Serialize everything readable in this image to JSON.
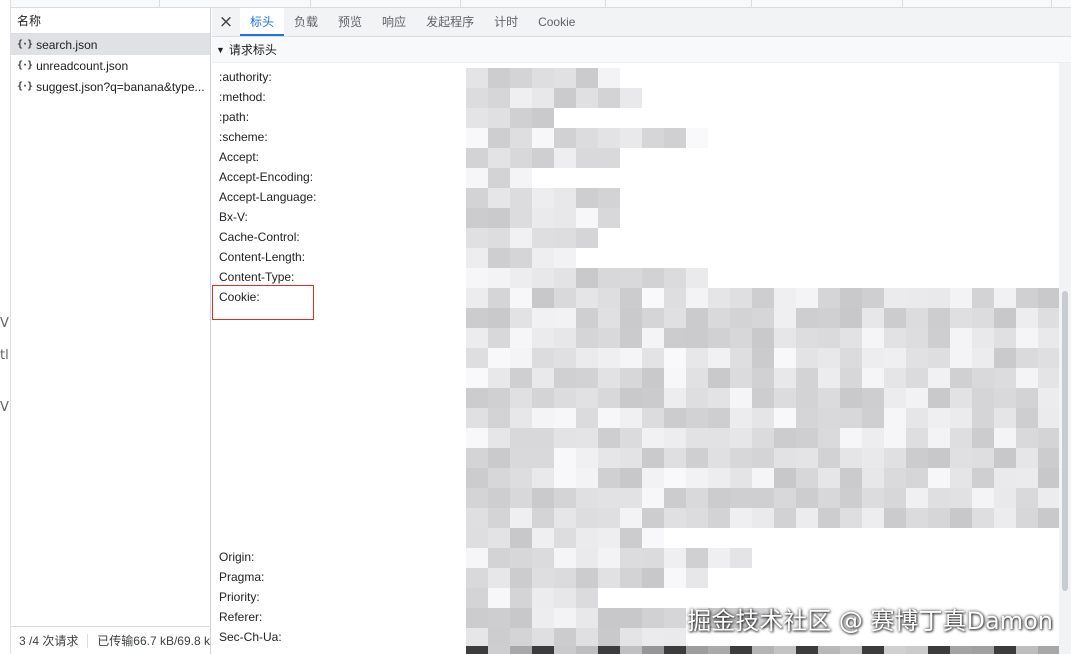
{
  "outside_fragments": [
    "V",
    "tl",
    "V"
  ],
  "request_list": {
    "header": "名称",
    "items": [
      {
        "icon": "{·}",
        "name": "search.json",
        "selected": true
      },
      {
        "icon": "{·}",
        "name": "unreadcount.json",
        "selected": false
      },
      {
        "icon": "{·}",
        "name": "suggest.json?q=banana&type...",
        "selected": false
      }
    ],
    "status": {
      "requests": "3 /4 次请求",
      "transferred": "已传输66.7 kB/69.8 k"
    }
  },
  "details": {
    "close_icon": "×",
    "tabs": [
      "标头",
      "负载",
      "预览",
      "响应",
      "发起程序",
      "计时",
      "Cookie"
    ],
    "active_tab": "标头",
    "section_title": "请求标头",
    "headers": [
      ":authority:",
      ":method:",
      ":path:",
      ":scheme:",
      "Accept:",
      "Accept-Encoding:",
      "Accept-Language:",
      "Bx-V:",
      "Cache-Control:",
      "Content-Length:",
      "Content-Type:",
      "Cookie:",
      "Origin:",
      "Pragma:",
      "Priority:",
      "Referer:",
      "Sec-Ch-Ua:"
    ],
    "highlighted_header": "Cookie:"
  },
  "watermark": "掘金技术社区 @ 赛博丁真Damon",
  "colors": {
    "accent": "#1a73e8",
    "highlight_box": "#d93025",
    "selected_row": "#dfe1e5"
  }
}
